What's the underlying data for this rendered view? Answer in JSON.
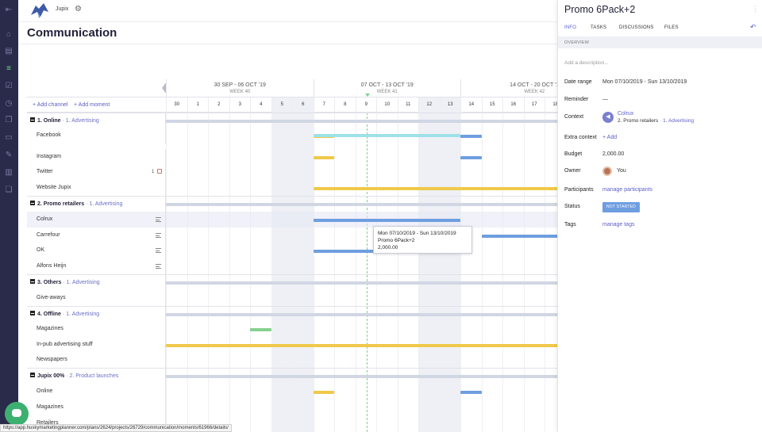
{
  "app": {
    "org_name": "Jupix",
    "page_title": "Communication",
    "status_url": "https://app.huskymarketingplanner.com/plans/2624/projects/26729/communication/moments/61966/details/"
  },
  "toolbar": {
    "add_channel": "+ Add channel",
    "add_moment": "+ Add moment"
  },
  "timeline": {
    "weeks": [
      {
        "label": "30 SEP - 06 OCT '19",
        "week": "WEEK 40"
      },
      {
        "label": "07 OCT - 13 OCT '19",
        "week": "WEEK 41"
      },
      {
        "label": "14 OCT - 20 OCT '1",
        "week": "WEEK 42"
      }
    ],
    "days": [
      "30",
      "1",
      "2",
      "3",
      "4",
      "5",
      "6",
      "7",
      "8",
      "9",
      "10",
      "11",
      "12",
      "13",
      "14",
      "15",
      "16",
      "17",
      "18"
    ]
  },
  "rows": [
    {
      "type": "group",
      "label": "1. Online",
      "sub": " · 1. Advertising"
    },
    {
      "type": "item",
      "label": "Facebook"
    },
    {
      "type": "item",
      "label": "Instagram"
    },
    {
      "type": "item",
      "label": "Twitter",
      "count": "1"
    },
    {
      "type": "item",
      "label": "Website Jupix"
    },
    {
      "type": "group",
      "label": "2. Promo retailers",
      "sub": " · 1. Advertising"
    },
    {
      "type": "item",
      "label": "Colrux"
    },
    {
      "type": "item",
      "label": "Carrefour"
    },
    {
      "type": "item",
      "label": "OK"
    },
    {
      "type": "item",
      "label": "Alfons Heijn"
    },
    {
      "type": "group",
      "label": "3. Others",
      "sub": " · 1. Advertising"
    },
    {
      "type": "item",
      "label": "Give-aways"
    },
    {
      "type": "group",
      "label": "4. Offline",
      "sub": " · 1. Advertising"
    },
    {
      "type": "item",
      "label": "Magazines"
    },
    {
      "type": "item",
      "label": "In-pub advertising stuff"
    },
    {
      "type": "item",
      "label": "Newspapers"
    },
    {
      "type": "group",
      "label": "Jupix 00%",
      "sub": " · 2. Product launches"
    },
    {
      "type": "item",
      "label": "Online"
    },
    {
      "type": "item",
      "label": "Magazines"
    },
    {
      "type": "item",
      "label": "Retailers"
    }
  ],
  "tooltip": {
    "dates": "Mon 07/10/2019   -   Sun 13/10/2019",
    "name": "Promo 6Pack+2",
    "budget": "2,000.00"
  },
  "panel": {
    "title": "Promo 6Pack+2",
    "more_icon": "⋮",
    "tabs": [
      "INFO",
      "TASKS",
      "DISCUSSIONS",
      "FILES"
    ],
    "active_tab": "INFO",
    "overview_label": "OVERVIEW",
    "description_placeholder": "Add a description...",
    "date_range_label": "Date range",
    "date_range_value": "Mon 07/10/2019   -   Sun 13/10/2019",
    "reminder_label": "Reminder",
    "reminder_value": "—",
    "context_label": "Context",
    "context_name": "Colrux",
    "context_group": "2. Promo retailers",
    "context_sub": " · 1. Advertising",
    "extra_context_label": "Extra context",
    "extra_context_add": "+ Add",
    "budget_label": "Budget",
    "budget_value": "2,000.00",
    "owner_label": "Owner",
    "owner_value": "You",
    "participants_label": "Participants",
    "participants_link": "manage participants",
    "status_label": "Status",
    "status_value": "NOT STARTED",
    "tags_label": "Tags",
    "tags_link": "manage tags"
  },
  "colors": {
    "accent": "#5b5fc7",
    "nav_bg": "#2a2b4a",
    "today": "#7bd389",
    "bar_yellow": "#f0c94a",
    "bar_blue": "#6f9ee0",
    "bar_cyan": "#9fe1e9",
    "bar_green": "#88d08f",
    "status_blue": "#6f9ee0"
  }
}
